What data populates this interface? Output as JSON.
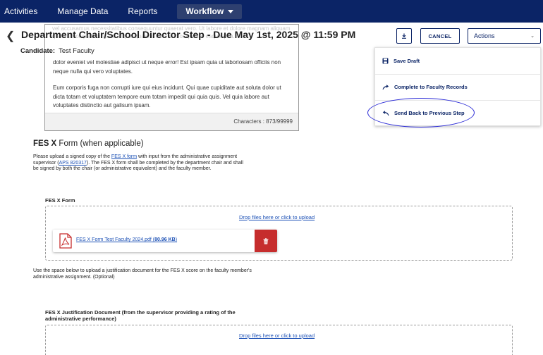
{
  "nav": {
    "items": [
      "Activities",
      "Manage Data",
      "Reports"
    ],
    "active": "Workflow"
  },
  "header": {
    "title": "Department Chair/School Director Step - Due May 1st, 2025 @ 11:59 PM",
    "candidate_label": "Candidate:",
    "candidate_value": "Test Faculty",
    "cancel_label": "CANCEL",
    "actions_label": "Actions"
  },
  "menu": {
    "items": [
      "Save Draft",
      "Complete to Faculty Records",
      "Send Back to Previous Step"
    ]
  },
  "textbox": {
    "faded_text": "vel accusamus necessitatibus consequuntur quaerat vero. Ut labore et dolore magnam aliquam quaerat voluptatem sit ea aliquid quaerat rerum dolor quo illo eaque ipsa.",
    "para1": "dolor eveniet vel molestiae adipisci ut neque error! Est ipsam quia ut laboriosam officiis non neque nulla qui vero voluptates.",
    "para2": "Eum corporis fuga non corrupti iure qui eius incidunt. Qui quae cupiditate aut soluta dolor ut dicta totam et voluptatem tempore eum totam impedit qui quia quis. Vel quia labore aut voluptates distinctio aut galisum ipsam.",
    "characters": "Characters : 873/99999"
  },
  "fes": {
    "title_bold": "FES X",
    "title_rest": " Form (when applicable)",
    "desc_1": "Please upload a signed copy of the ",
    "desc_link1": "FES X form",
    "desc_2": " with input from the administrative assignment supervisor (",
    "desc_link2": "APS 820317",
    "desc_3": "). The FES X form shall be completed by the department chair and shall be signed by both the chair (or administrative equivalent) and the faculty member.",
    "form_label": "FES X Form",
    "drop_text": "Drop files here or click to upload",
    "file_name": "FES X Form Test Faculty 2024.pdf",
    "file_size": "80.96 KB",
    "justify_desc": "Use the space below to upload a justification document for the FES X score on the faculty member's administrative assignment. (Optional)",
    "just_label": "FES X Justification Document (from the supervisor providing a rating of the administrative performance)",
    "drop_text2": "Drop files here or click to upload"
  },
  "colors": {
    "nav_bg": "#0b2466",
    "accent": "#0b2466",
    "link": "#1a4fb5",
    "delete": "#c62d2d",
    "highlight": "#2b2bd6"
  }
}
